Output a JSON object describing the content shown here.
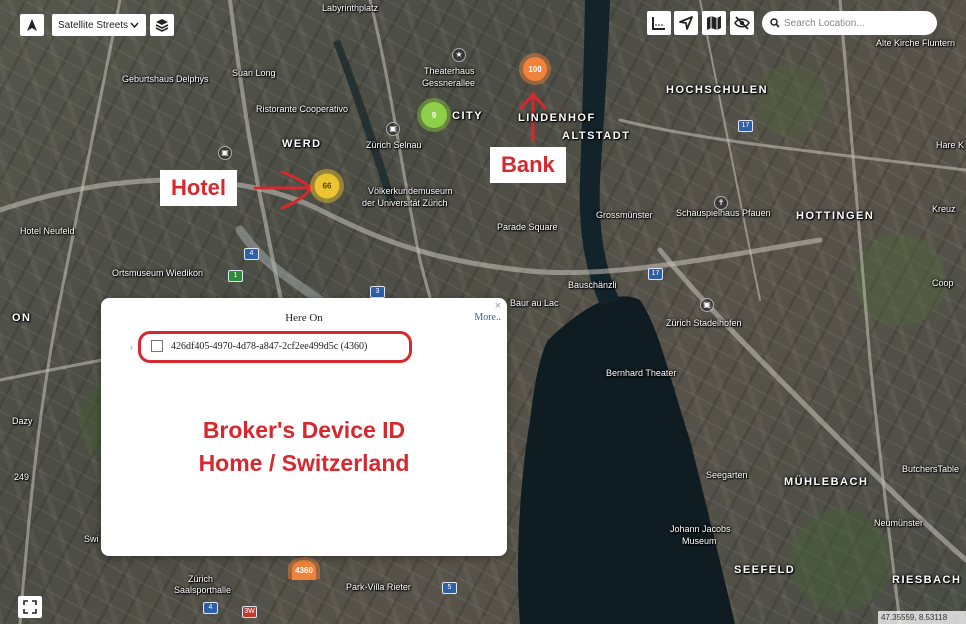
{
  "toolbar": {
    "map_style": "Satellite Streets",
    "search_placeholder": "Search Location..."
  },
  "clusters": {
    "top": "100",
    "green": "9",
    "yellow": "66",
    "bottom": "4360"
  },
  "annotations": {
    "hotel": "Hotel",
    "bank": "Bank",
    "popup_line1": "Broker's Device ID",
    "popup_line2": "Home / Switzerland"
  },
  "popup": {
    "title": "Here On",
    "more": "More..",
    "close": "×",
    "chevron": "›",
    "device_entry": "426df405-4970-4d78-a847-2cf2ee499d5c (4360)"
  },
  "places": {
    "labyrinthplatz": "Labyrinthplatz",
    "geburtshaus": "Geburtshaus Delphys",
    "suan_long": "Suan Long",
    "ristorante": "Ristorante Cooperativo",
    "theaterhaus": "Theaterhaus",
    "gessnerallee": "Gessnerallee",
    "city": "CITY",
    "lindenhof": "LINDENHOF",
    "altstadt": "ALTSTADT",
    "hochschulen": "HOCHSCHULEN",
    "alte_kirche": "Alte Kirche Fluntern",
    "hare_k": "Hare K",
    "werd": "WERD",
    "zurich_selnau": "Zürich Selnau",
    "volkerkunde1": "Völkerkundemuseum",
    "volkerkunde2": "der Universität Zürich",
    "grossmunster": "Grossmünster",
    "schauspielhaus": "Schauspielhaus Pfauen",
    "hottingen": "HOTTINGEN",
    "kreuz": "Kreuz",
    "hotel_neufeld": "Hotel Neufeld",
    "parade_square": "Parade Square",
    "ortsmuseum": "Ortsmuseum Wiedikon",
    "bauschanzli": "Bauschänzli",
    "baur_au_lac": "Baur au Lac",
    "zurich_stadelhofen": "Zürich Stadelhofen",
    "coop": "Coop",
    "bernhard_theater": "Bernhard Theater",
    "seegarten": "Seegarten",
    "muhlebach": "MÜHLEBACH",
    "butchers_table": "ButchersTable",
    "johann_jacobs1": "Johann Jacobs",
    "johann_jacobs2": "Museum",
    "neumunster": "Neumünster",
    "seefeld": "SEEFELD",
    "riesbach": "RIESBACH",
    "zurich_saal1": "Zürich",
    "zurich_saal2": "Saalsporthalle",
    "park_villa": "Park-Villa Rieter",
    "dazy": "Dazy",
    "swi": "Swi",
    "n249": "249",
    "on": "ON"
  },
  "shields": {
    "s17a": "17",
    "s17b": "17",
    "s4a": "4",
    "s1": "1",
    "s3": "3",
    "s4b": "4",
    "s3w": "3W",
    "s5": "5"
  },
  "scale_text": "47.35559, 8.53118"
}
